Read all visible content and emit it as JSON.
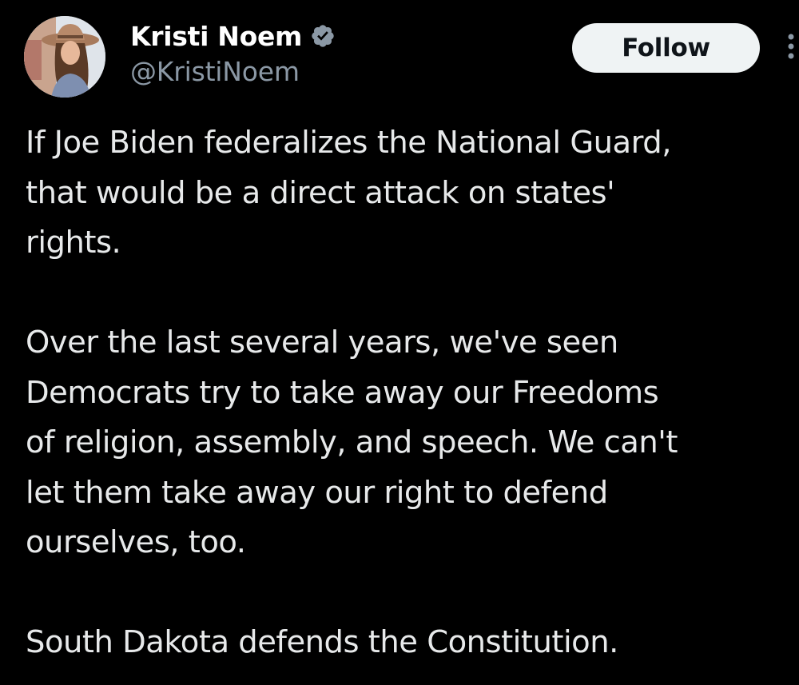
{
  "author": {
    "display_name": "Kristi Noem",
    "handle": "@KristiNoem",
    "verified_icon": "verified-badge-icon"
  },
  "actions": {
    "follow_label": "Follow",
    "more_icon": "more-options-icon"
  },
  "tweet": {
    "paragraphs": [
      {
        "lines": [
          "If Joe Biden federalizes the National Guard,",
          "that would be a direct attack on states'",
          "rights."
        ]
      },
      {
        "lines": [
          "Over the last several years, we've seen",
          "Democrats try to take away our Freedoms",
          "of religion, assembly, and speech. We can't",
          "let them take away our right to defend",
          "ourselves, too."
        ]
      },
      {
        "lines": [
          "South Dakota defends the Constitution."
        ]
      }
    ]
  },
  "colors": {
    "background": "#000000",
    "text": "#e7e9ea",
    "secondary_text": "#8b98a5",
    "verified_badge": "#8b98a5",
    "button_bg": "#eff3f4",
    "button_text": "#0f1419"
  }
}
